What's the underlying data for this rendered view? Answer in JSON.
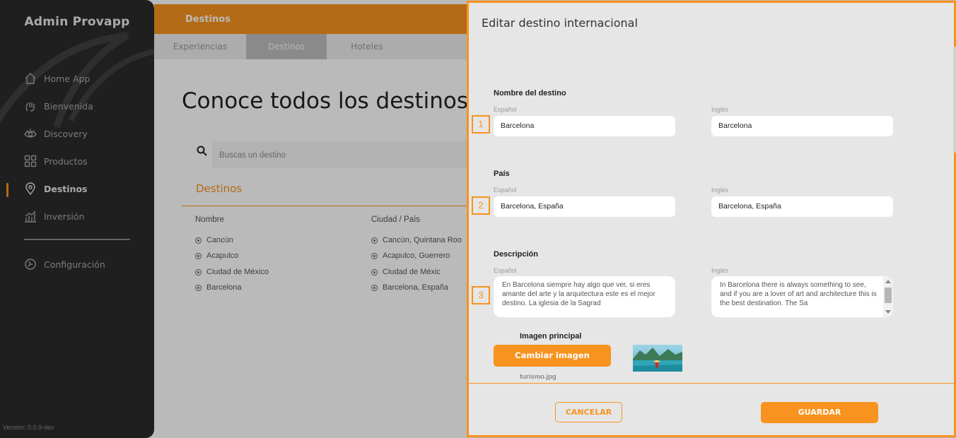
{
  "app": {
    "brand": "Admin Provapp",
    "version": "Version: 0.0.9-dev"
  },
  "sidebar": {
    "items": [
      {
        "label": "Home App",
        "icon": "home-icon"
      },
      {
        "label": "Bienvenida",
        "icon": "hand-wave-icon"
      },
      {
        "label": "Discovery",
        "icon": "eye-icon"
      },
      {
        "label": "Productos",
        "icon": "grid-icon"
      },
      {
        "label": "Destinos",
        "icon": "map-pin-icon",
        "active": true
      },
      {
        "label": "Inversión",
        "icon": "chart-icon"
      }
    ],
    "settings": {
      "label": "Configuración",
      "icon": "gear-icon"
    }
  },
  "header": {
    "title": "Destinos",
    "tabs": [
      "Experiencias",
      "Destinos",
      "Hoteles"
    ],
    "active_tab": "Destinos"
  },
  "main": {
    "heading": "Conoce todos los destinos d",
    "search_placeholder": "Buscas un destino",
    "section_label": "Destinos",
    "columns": [
      "Nombre",
      "Ciudad / País"
    ],
    "rows": [
      {
        "name": "Cancún",
        "city": "Cancún, Quintana Roo"
      },
      {
        "name": "Acapulco",
        "city": "Acapulco, Guerrero"
      },
      {
        "name": "Ciudad de México",
        "city": "Ciudad de Méxic"
      },
      {
        "name": "Barcelona",
        "city": "Barcelona, España"
      }
    ]
  },
  "modal": {
    "title": "Editar destino internacional",
    "nombre": {
      "section": "Nombre del destino",
      "marker": "1",
      "es_label": "Español",
      "en_label": "Inglés",
      "es_value": "Barcelona",
      "en_value": "Barcelona"
    },
    "pais": {
      "section": "País",
      "marker": "2",
      "es_label": "Español",
      "en_label": "Inglés",
      "es_value": "Barcelona, España",
      "en_value": "Barcelona, España"
    },
    "descripcion": {
      "section": "Descripción",
      "marker": "3",
      "es_label": "Español",
      "en_label": "Inglés",
      "es_value": "En Barcelona siempre hay algo que ver, si eres amante del arte y la arquitectura este es el mejor destino. La iglesia de la Sagrad",
      "en_value": "In Barcelona there is always something to see, and if you are a lover of art and architecture this is the best destination. The Sa"
    },
    "image": {
      "label": "Imagen principal",
      "change_button": "Cambiar imagen",
      "filename": "turismo.jpg"
    },
    "cancel_button": "CANCELAR",
    "save_button": "GUARDAR"
  },
  "colors": {
    "accent": "#f7931e",
    "sidebar_bg": "#2b2b2b",
    "modal_bg": "#e6e6e6"
  }
}
